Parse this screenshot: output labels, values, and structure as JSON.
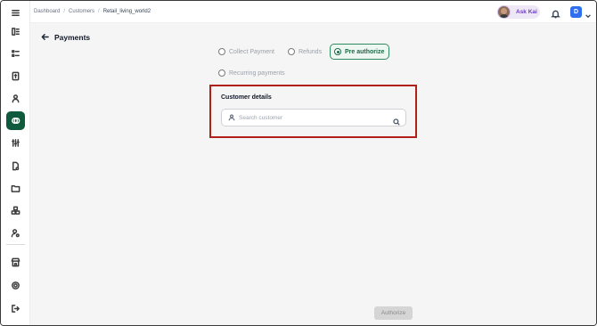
{
  "breadcrumb": {
    "items": [
      "Dashboard",
      "Customers",
      "Retail_living_world2"
    ],
    "separator": "/"
  },
  "topbar": {
    "ask_kai_label": "Ask Kai",
    "user_initial": "D"
  },
  "page": {
    "title": "Payments"
  },
  "payment_options": [
    {
      "label": "Collect Payment",
      "selected": false
    },
    {
      "label": "Refunds",
      "selected": false
    },
    {
      "label": "Pre authorize",
      "selected": true
    },
    {
      "label": "Recurring payments",
      "selected": false
    }
  ],
  "customer_details": {
    "title": "Customer details",
    "search_placeholder": "Search customer"
  },
  "footer": {
    "authorize_label": "Authorize"
  },
  "sidebar": {
    "items": [
      {
        "icon": "menu-icon",
        "active": false
      },
      {
        "icon": "layout-icon",
        "active": false
      },
      {
        "icon": "list-icon",
        "active": false
      },
      {
        "icon": "invoice-icon",
        "active": false
      },
      {
        "icon": "user-icon",
        "active": false
      },
      {
        "icon": "payments-icon",
        "active": true
      },
      {
        "icon": "sliders-icon",
        "active": false
      },
      {
        "icon": "file-search-icon",
        "active": false
      },
      {
        "icon": "folder-icon",
        "active": false
      },
      {
        "icon": "boxes-icon",
        "active": false
      },
      {
        "icon": "user-settings-icon",
        "active": false
      },
      {
        "icon": "store-icon",
        "active": false
      },
      {
        "icon": "gear-icon",
        "active": false
      },
      {
        "icon": "logout-icon",
        "active": false
      }
    ]
  },
  "colors": {
    "accent": "#0f5a3d",
    "highlight_border": "#b0211a",
    "ask_kai_text": "#6d3fc0",
    "user_badge": "#2f6fed"
  }
}
